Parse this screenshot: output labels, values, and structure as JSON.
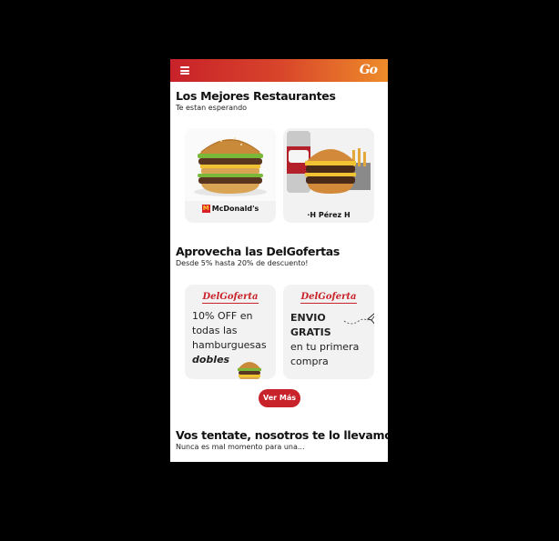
{
  "header": {
    "logo": "Go",
    "menu_icon": "hamburger-icon"
  },
  "restaurants": {
    "title": "Los Mejores Restaurantes",
    "subtitle": "Te estan esperando",
    "items": [
      {
        "label": "McDonald's",
        "logo_icon": "mcdonalds-logo-icon"
      },
      {
        "label": "Pérez H",
        "logo_icon": "perez-h-logo-icon"
      }
    ]
  },
  "offers": {
    "title": "Aprovecha las DelGofertas",
    "subtitle": "Desde 5% hasta 20% de descuento!",
    "brand": "DelGoferta",
    "items": [
      {
        "lines": [
          "10% OFF en",
          "todas las",
          "hamburguesas"
        ],
        "emphasis": "dobles"
      },
      {
        "lines_bold": [
          "ENVIO",
          "GRATIS"
        ],
        "lines": [
          "en tu primera",
          "compra"
        ]
      }
    ],
    "more_button": "Ver Más"
  },
  "delivery": {
    "title": "Vos tentate, nosotros te lo llevamos",
    "subtitle": "Nunca es mal momento para una..."
  },
  "colors": {
    "accent": "#c8222a",
    "gradient_end": "#ee8c2a",
    "card_bg": "#f2f2f2"
  }
}
